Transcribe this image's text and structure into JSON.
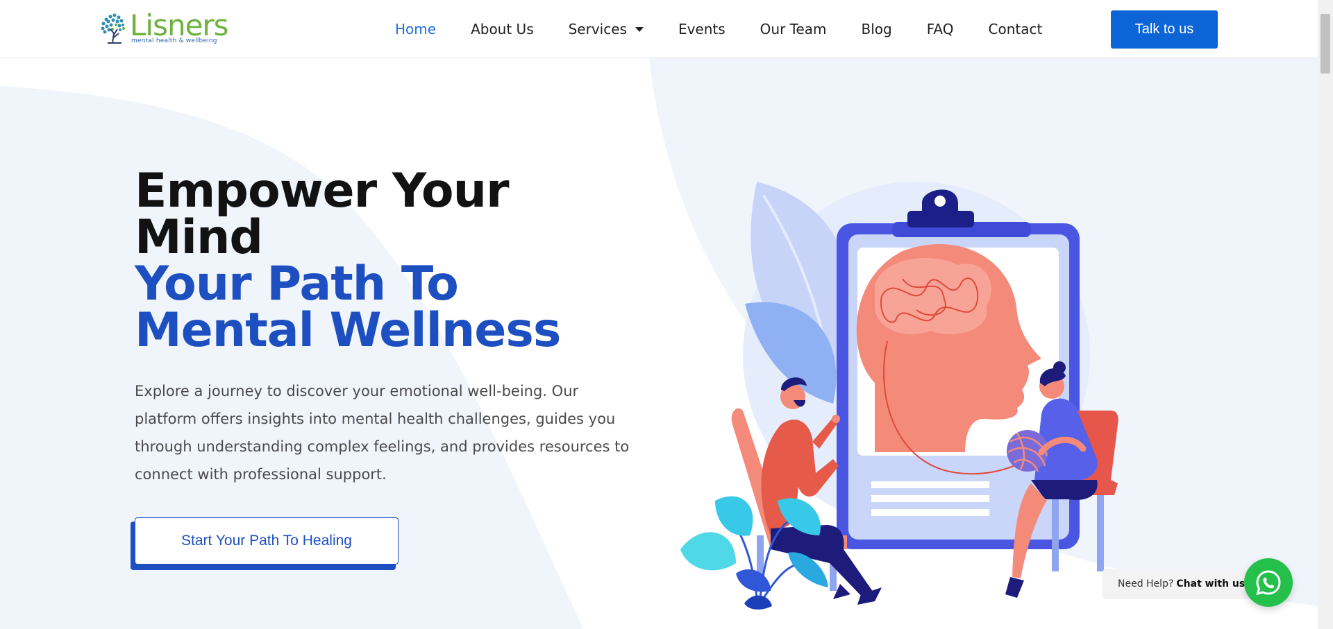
{
  "brand": {
    "name": "Lisners",
    "tagline": "mental health & wellbeing"
  },
  "nav": {
    "items": [
      {
        "label": "Home",
        "active": true
      },
      {
        "label": "About Us"
      },
      {
        "label": "Services",
        "has_dropdown": true
      },
      {
        "label": "Events"
      },
      {
        "label": "Our Team"
      },
      {
        "label": "Blog"
      },
      {
        "label": "FAQ"
      },
      {
        "label": "Contact"
      }
    ],
    "cta_label": "Talk to us"
  },
  "hero": {
    "headline_line1": "Empower Your",
    "headline_line2": "Mind",
    "highlight_line1": "Your Path To",
    "highlight_line2": "Mental Wellness",
    "description": "Explore a journey to discover your emotional well-being. Our platform offers insights into mental health challenges, guides you through understanding complex feelings, and provides resources to connect with professional support.",
    "cta_label": "Start Your Path To Healing"
  },
  "chat_widget": {
    "prefix": "Need Help?",
    "label": "Chat with us",
    "icon": "whatsapp-icon"
  },
  "colors": {
    "primary_blue": "#0c64d6",
    "headline_blue": "#1d4fc0",
    "brand_green": "#6cb23c",
    "whatsapp_green": "#25c04c",
    "hero_bg": "#f0f5fc"
  }
}
